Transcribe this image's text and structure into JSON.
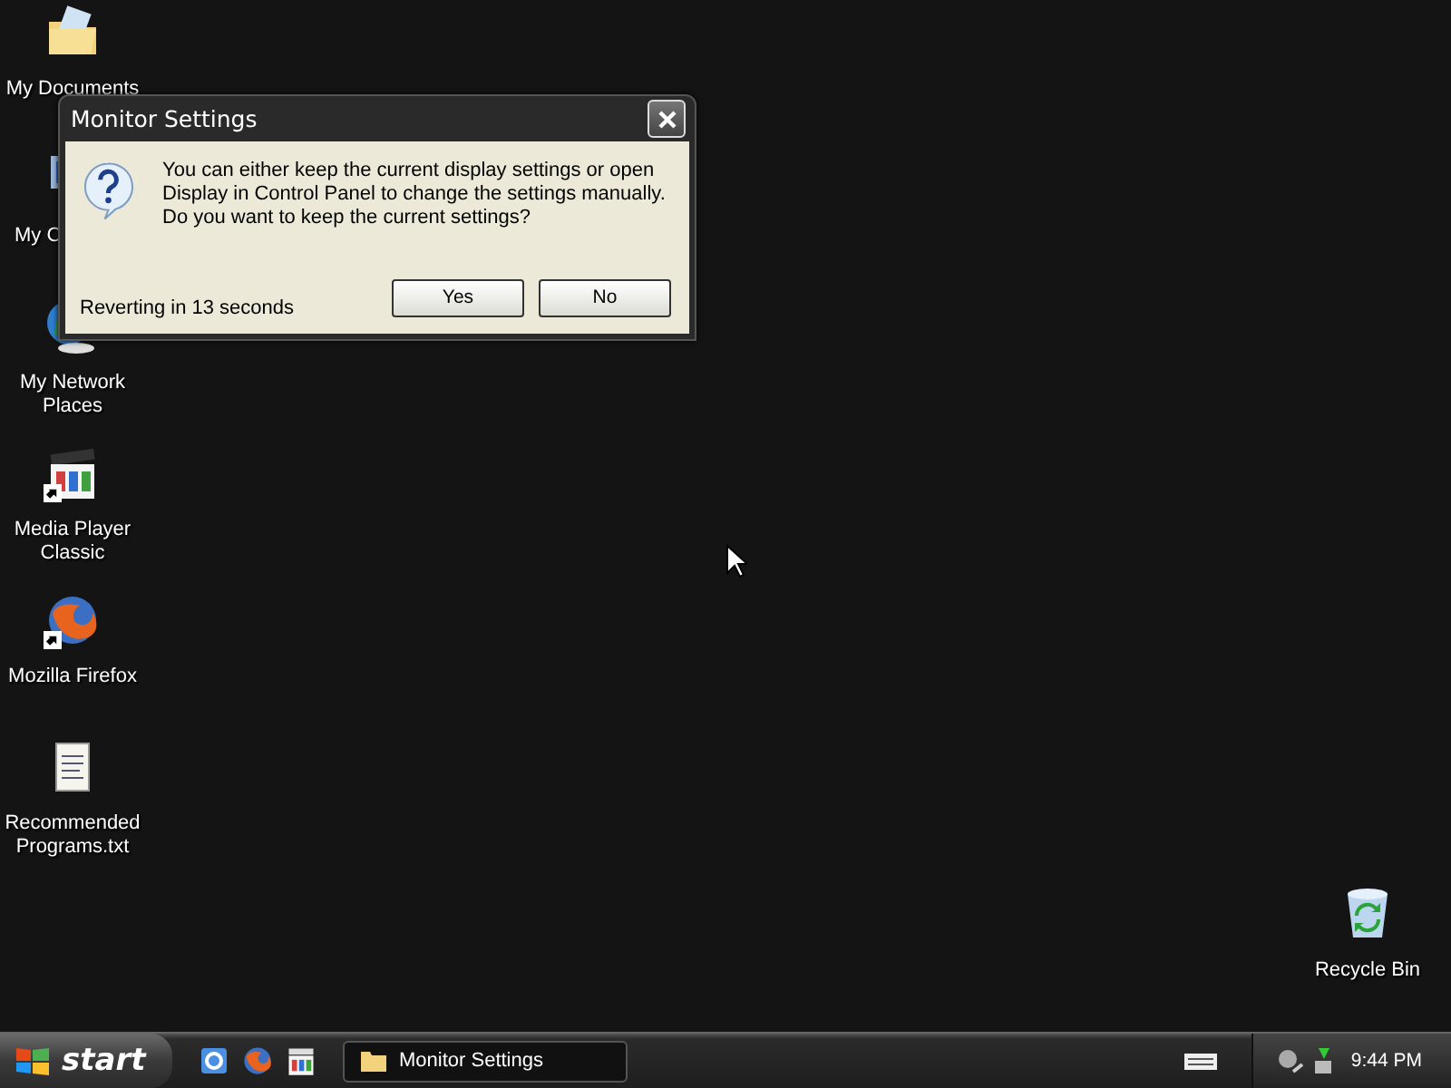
{
  "desktop_icons": [
    {
      "label": "My Documents",
      "kind": "documents"
    },
    {
      "label": "My C",
      "kind": "computer"
    },
    {
      "label": "My Network Places",
      "kind": "network"
    },
    {
      "label": "Media Player Classic",
      "kind": "mediaplayer",
      "shortcut": true
    },
    {
      "label": "Mozilla Firefox",
      "kind": "firefox",
      "shortcut": true
    },
    {
      "label": "Recommended Programs.txt",
      "kind": "textfile"
    }
  ],
  "recycle_bin": {
    "label": "Recycle Bin",
    "kind": "recyclebin"
  },
  "dialog": {
    "title": "Monitor Settings",
    "message": "You can either keep the current display settings or open Display in Control Panel to change the settings manually. Do you want to keep the current settings?",
    "countdown": "Reverting in 13 seconds",
    "buttons": [
      "Yes",
      "No"
    ]
  },
  "taskbar": {
    "start": "start",
    "quick_launch": [
      {
        "kind": "ie"
      },
      {
        "kind": "firefox"
      },
      {
        "kind": "mediaplayer"
      }
    ],
    "tasks": [
      {
        "label": "Monitor Settings",
        "selected": true
      }
    ],
    "clock": "9:44 PM"
  }
}
